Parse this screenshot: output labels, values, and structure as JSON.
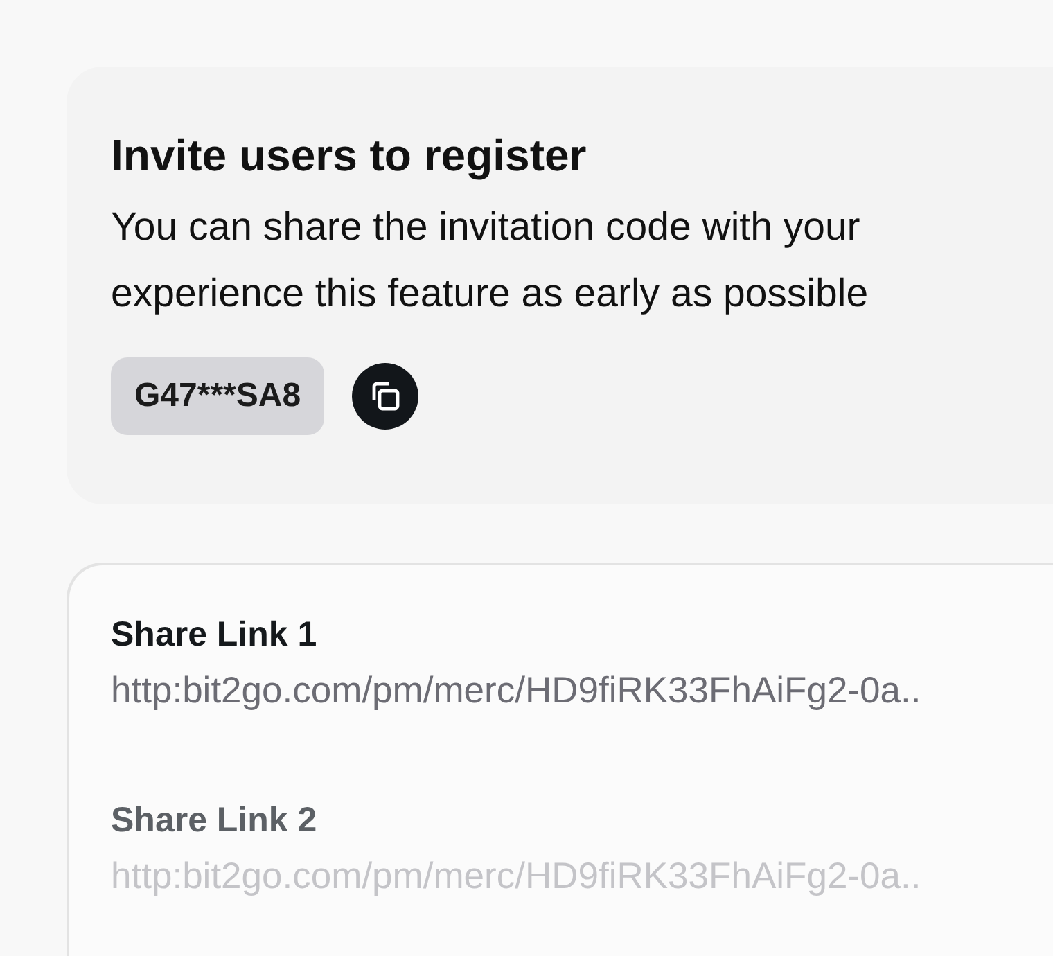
{
  "invite": {
    "title": "Invite users to register",
    "description_lines": [
      "You can share the invitation code with your",
      "experience this feature as early as possible"
    ],
    "code": "G47***SA8"
  },
  "share_links": [
    {
      "label": "Share Link 1",
      "url": "http:bit2go.com/pm/merc/HD9fiRK33FhAiFg2-0a.."
    },
    {
      "label": "Share Link 2",
      "url": "http:bit2go.com/pm/merc/HD9fiRK33FhAiFg2-0a.."
    }
  ]
}
